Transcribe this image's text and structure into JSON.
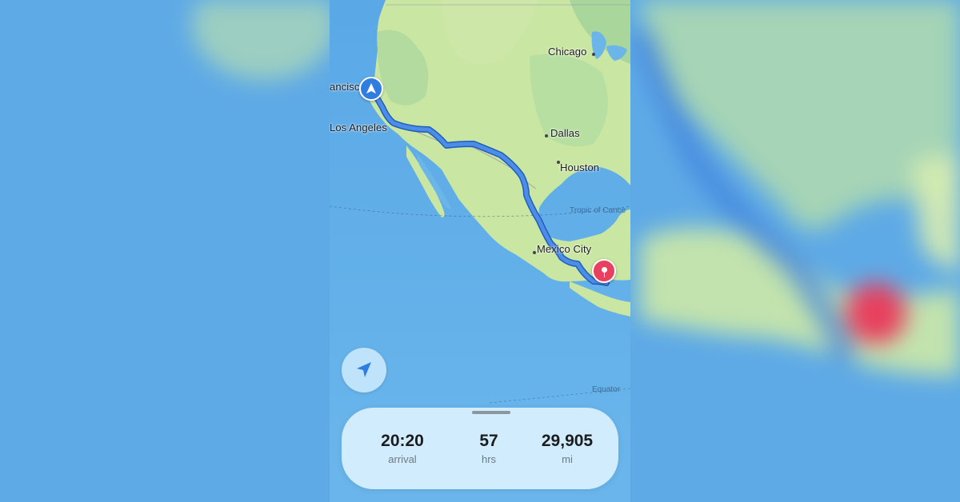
{
  "map": {
    "cities": [
      {
        "id": "chicago",
        "label": "Chicago"
      },
      {
        "id": "san-francisco",
        "label": "ancisco"
      },
      {
        "id": "los-angeles",
        "label": "Los Angeles"
      },
      {
        "id": "dallas",
        "label": "Dallas"
      },
      {
        "id": "houston",
        "label": "Houston"
      },
      {
        "id": "mexico-city",
        "label": "Mexico City"
      }
    ],
    "lines": {
      "tropic": "Tropic of Cance",
      "equator": "Equator"
    },
    "colors": {
      "route": "#3f7fdc",
      "destination_pin": "#e8405e",
      "start_marker": "#2f7de0"
    },
    "icons": {
      "start": "navigation-arrow-icon",
      "destination": "map-pin-icon",
      "locate": "location-arrow-icon"
    }
  },
  "trip_summary": {
    "arrival": {
      "value": "20:20",
      "unit": "arrival"
    },
    "duration": {
      "value": "57",
      "unit": "hrs"
    },
    "distance": {
      "value": "29,905",
      "unit": "mi"
    }
  }
}
